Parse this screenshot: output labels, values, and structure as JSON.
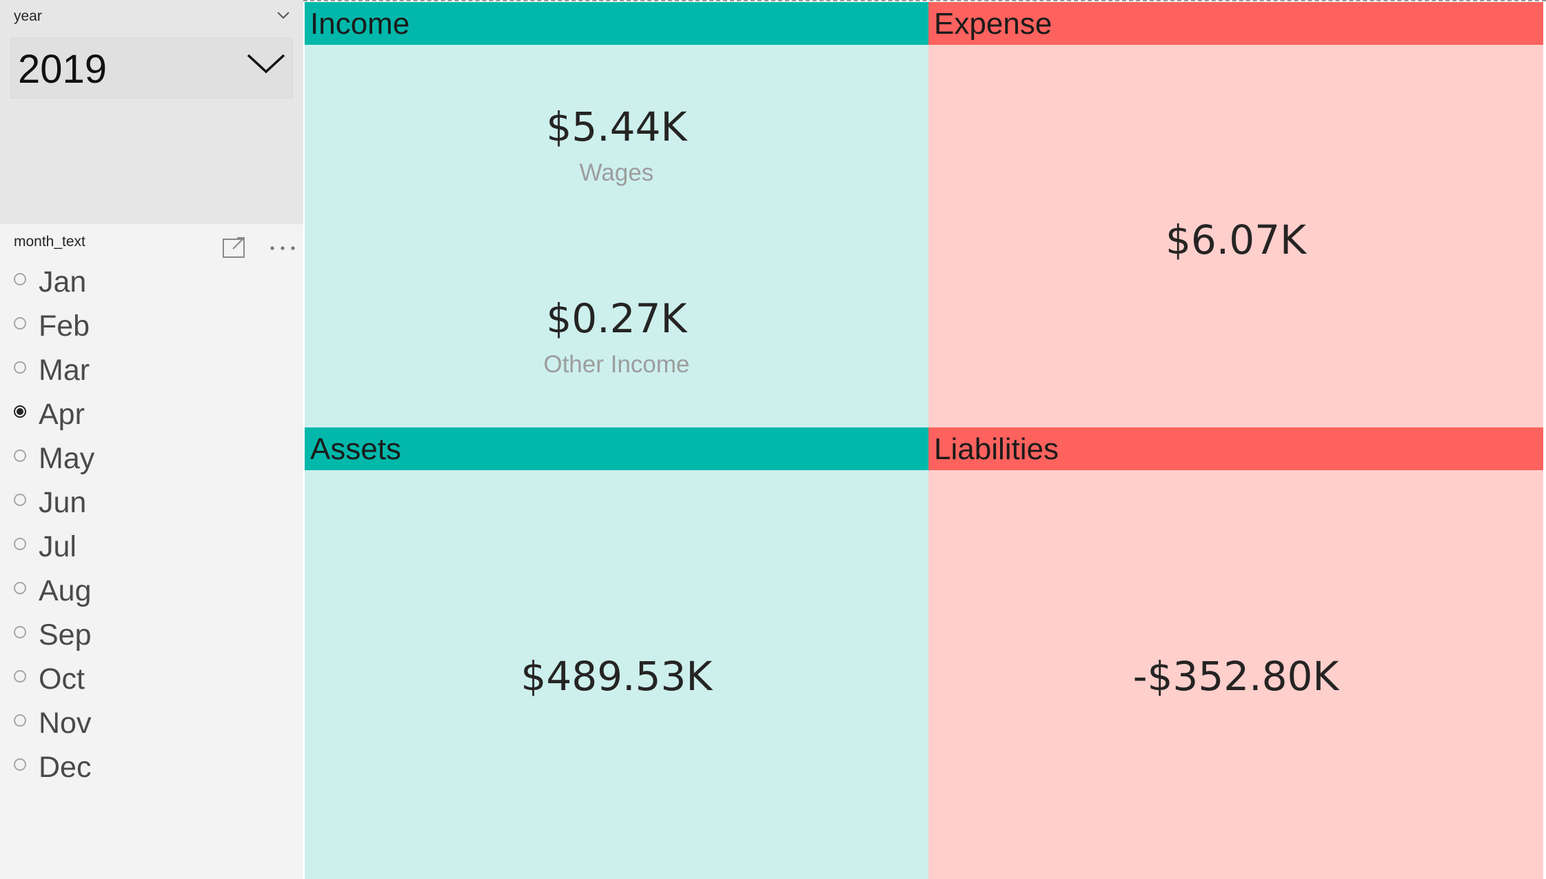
{
  "year_slicer": {
    "title": "year",
    "selected_value": "2019"
  },
  "month_slicer": {
    "title": "month_text",
    "selected": "Apr",
    "items": [
      {
        "label": "Jan",
        "selected": false
      },
      {
        "label": "Feb",
        "selected": false
      },
      {
        "label": "Mar",
        "selected": false
      },
      {
        "label": "Apr",
        "selected": true
      },
      {
        "label": "May",
        "selected": false
      },
      {
        "label": "Jun",
        "selected": false
      },
      {
        "label": "Jul",
        "selected": false
      },
      {
        "label": "Aug",
        "selected": false
      },
      {
        "label": "Sep",
        "selected": false
      },
      {
        "label": "Oct",
        "selected": false
      },
      {
        "label": "Nov",
        "selected": false
      },
      {
        "label": "Dec",
        "selected": false
      }
    ]
  },
  "tiles": {
    "income": {
      "title": "Income",
      "cards": [
        {
          "value": "$5.44K",
          "label": "Wages"
        },
        {
          "value": "$0.27K",
          "label": "Other Income"
        }
      ]
    },
    "expense": {
      "title": "Expense",
      "value": "$6.07K"
    },
    "assets": {
      "title": "Assets",
      "value": "$489.53K"
    },
    "liabilities": {
      "title": "Liabilities",
      "value": "-$352.80K"
    }
  },
  "colors": {
    "teal_header": "#01b8aa",
    "teal_body": "#cdf0ed",
    "red_header": "#fd625e",
    "red_body": "#ffcfcc"
  },
  "icons": {
    "year_header": "chevron-down-icon",
    "year_dropdown": "chevron-down-icon",
    "focus_mode": "focus-mode-icon",
    "more_options": "more-options-icon"
  }
}
